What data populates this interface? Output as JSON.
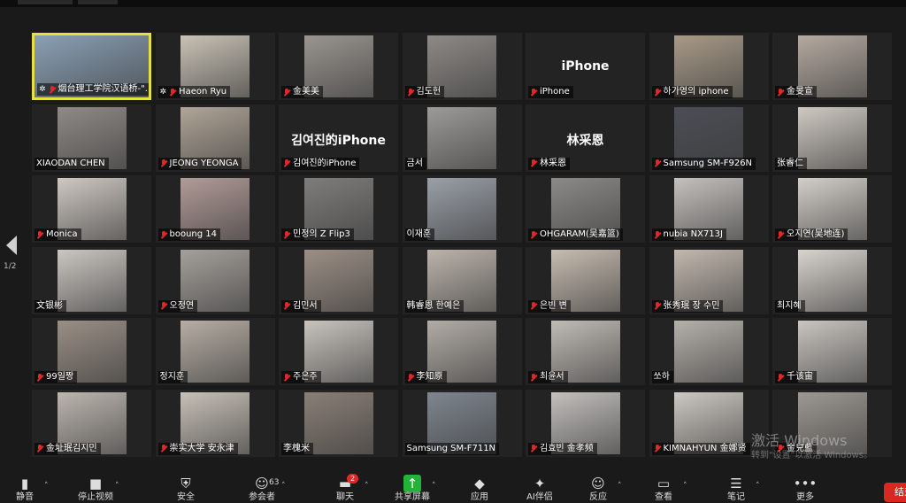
{
  "page_indicator": "1/2",
  "watermark": {
    "line1": "激活 Windows",
    "line2": "转到\"设置\"以激活 Windows。"
  },
  "participants": [
    {
      "name": "烟台理工学院汉语桥-\"...",
      "pinned": true,
      "active": true,
      "video": "#8aa0b5"
    },
    {
      "name": "Haeon Ryu",
      "pinned": true,
      "video": "#c9c2b5"
    },
    {
      "name": "金美美",
      "video": "#9a9590"
    },
    {
      "name": "김도헌",
      "video": "#8e8a86"
    },
    {
      "name": "iPhone",
      "big": "iPhone"
    },
    {
      "name": "하가영의 iphone",
      "video": "#a89a88"
    },
    {
      "name": "金旻宣",
      "video": "#b5aaa0"
    },
    {
      "name": "XIAODAN CHEN",
      "video": "#8f8a86",
      "nomute": true
    },
    {
      "name": "JEONG YEONGA",
      "video": "#b0a597"
    },
    {
      "name": "김여진的iPhone",
      "big": "김여진的iPhone"
    },
    {
      "name": "금서",
      "video": "#9d9b99",
      "nomute": true
    },
    {
      "name": "林采恩",
      "big": "林采恩"
    },
    {
      "name": "Samsung SM-F926N",
      "video": "#4b4e55"
    },
    {
      "name": "张睿仁",
      "video": "#cfc9c2",
      "nomute": true
    },
    {
      "name": "Monica",
      "video": "#cfc8c2"
    },
    {
      "name": "booung 14",
      "video": "#b19b97"
    },
    {
      "name": "민정의 Z Flip3",
      "video": "#7f7d7c"
    },
    {
      "name": "이재훈",
      "video": "#9aa0a8",
      "nomute": true
    },
    {
      "name": "OHGARAM(吴嘉篮)",
      "video": "#8c8a87"
    },
    {
      "name": "nubia NX713J",
      "video": "#c5c1bd"
    },
    {
      "name": "오지연(吴地连)",
      "video": "#d3cec8"
    },
    {
      "name": "文银彬",
      "video": "#cbc6c1",
      "nomute": true
    },
    {
      "name": "오정연",
      "video": "#a5a09b"
    },
    {
      "name": "김민서",
      "video": "#9c8f85"
    },
    {
      "name": "韩睿恩 한예은",
      "video": "#bcb4ab",
      "nomute": true
    },
    {
      "name": "은빈 변",
      "video": "#c7bcb0"
    },
    {
      "name": "张秀珉 장 수민",
      "video": "#c2b8ae"
    },
    {
      "name": "최지혜",
      "video": "#d8d3cd",
      "nomute": true
    },
    {
      "name": "99일짱",
      "video": "#9a8f85"
    },
    {
      "name": "정지훈",
      "video": "#b7aea4",
      "nomute": true
    },
    {
      "name": "주은주",
      "video": "#c8c3bd"
    },
    {
      "name": "李知原",
      "video": "#b2aca6"
    },
    {
      "name": "최윤서",
      "video": "#c0bbb5"
    },
    {
      "name": "쏘하",
      "video": "#b5b0aa",
      "nomute": true
    },
    {
      "name": "千该宙",
      "video": "#c9c5c0"
    },
    {
      "name": "金址珉김지민",
      "video": "#bdb6af"
    },
    {
      "name": "崇实大学 安永津",
      "video": "#c7c0b7"
    },
    {
      "name": "李槐米",
      "video": "#8a7f76",
      "nomute": true
    },
    {
      "name": "Samsung SM-F711N",
      "video": "#7f8690",
      "nomute": true
    },
    {
      "name": "김효빈 金孝频",
      "video": "#c3c0bd"
    },
    {
      "name": "KIMNAHYUN 金娜贤",
      "video": "#cdc8c2"
    },
    {
      "name": "金兒藍",
      "video": "#9d9892"
    }
  ],
  "toolbar": {
    "participants_count": "63",
    "chat_badge": "2",
    "items": [
      {
        "icon": "microphone-icon",
        "label": "静音"
      },
      {
        "icon": "camera-icon",
        "label": "停止视频"
      },
      {
        "icon": "shield-icon",
        "label": "安全"
      },
      {
        "icon": "participants-icon",
        "label": "参会者"
      },
      {
        "icon": "chat-icon",
        "label": "聊天"
      },
      {
        "icon": "share-screen-icon",
        "label": "共享屏幕"
      },
      {
        "icon": "apps-icon",
        "label": "应用"
      },
      {
        "icon": "ai-sparkle-icon",
        "label": "AI伴侣"
      },
      {
        "icon": "reactions-icon",
        "label": "反应"
      },
      {
        "icon": "view-icon",
        "label": "查看"
      },
      {
        "icon": "notes-icon",
        "label": "笔记"
      },
      {
        "icon": "more-icon",
        "label": "更多"
      }
    ],
    "end_label": "结束"
  },
  "colors": {
    "active_border": "#e7e041",
    "mute_red": "#e02828",
    "share_green": "#23b33a",
    "end_red": "#d8281f"
  }
}
